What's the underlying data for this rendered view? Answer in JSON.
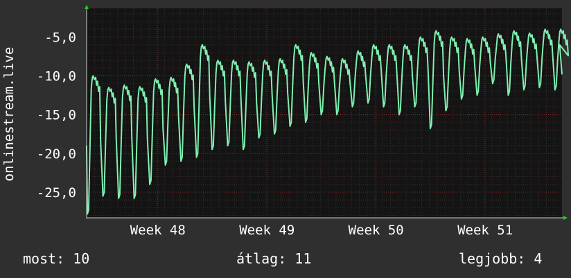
{
  "chart_data": {
    "type": "line",
    "ylabel": "onlinestream.live",
    "xlabel": "",
    "title": "",
    "ylim": [
      -28.3,
      -1.3
    ],
    "yticks": [
      -5,
      -10,
      -15,
      -20,
      -25
    ],
    "ytick_labels": [
      "-5,0",
      "-10,0",
      "-15,0",
      "-20,0",
      "-25,0"
    ],
    "xlim": [
      0,
      30.5
    ],
    "xticks": [
      {
        "x": 4.57,
        "label": "Week 48"
      },
      {
        "x": 11.57,
        "label": "Week 49"
      },
      {
        "x": 18.57,
        "label": "Week 50"
      },
      {
        "x": 25.57,
        "label": "Week 51"
      }
    ],
    "grid": true,
    "line_color": "#7ff0b0",
    "x_unit": "days",
    "series": [
      {
        "daily": [
          {
            "peak": -10.0,
            "trough": -27.8
          },
          {
            "peak": -11.5,
            "trough": -25.5
          },
          {
            "peak": -11.2,
            "trough": -25.8
          },
          {
            "peak": -11.4,
            "trough": -25.8
          },
          {
            "peak": -10.4,
            "trough": -24.0
          },
          {
            "peak": -10.2,
            "trough": -21.5
          },
          {
            "peak": -8.5,
            "trough": -21.0
          },
          {
            "peak": -6.0,
            "trough": -20.5
          },
          {
            "peak": -8.0,
            "trough": -19.5
          },
          {
            "peak": -8.0,
            "trough": -19.0
          },
          {
            "peak": -8.2,
            "trough": -19.5
          },
          {
            "peak": -8.0,
            "trough": -18.0
          },
          {
            "peak": -7.8,
            "trough": -17.5
          },
          {
            "peak": -6.0,
            "trough": -16.5
          },
          {
            "peak": -7.0,
            "trough": -16.0
          },
          {
            "peak": -7.5,
            "trough": -15.0
          },
          {
            "peak": -7.8,
            "trough": -15.0
          },
          {
            "peak": -6.8,
            "trough": -14.0
          },
          {
            "peak": -6.0,
            "trough": -13.5
          },
          {
            "peak": -6.0,
            "trough": -14.0
          },
          {
            "peak": -6.0,
            "trough": -15.0
          },
          {
            "peak": -5.0,
            "trough": -14.0
          },
          {
            "peak": -4.2,
            "trough": -16.8
          },
          {
            "peak": -5.0,
            "trough": -14.5
          },
          {
            "peak": -5.2,
            "trough": -13.0
          },
          {
            "peak": -5.0,
            "trough": -12.5
          },
          {
            "peak": -4.6,
            "trough": -11.0
          },
          {
            "peak": -4.2,
            "trough": -12.5
          },
          {
            "peak": -4.5,
            "trough": -11.8
          },
          {
            "peak": -4.0,
            "trough": -11.5
          },
          {
            "peak": -4.0,
            "trough": -11.8
          }
        ]
      }
    ]
  },
  "footer": {
    "current": "most: 10",
    "average": "átlag: 11",
    "best": "legjobb: 4"
  }
}
